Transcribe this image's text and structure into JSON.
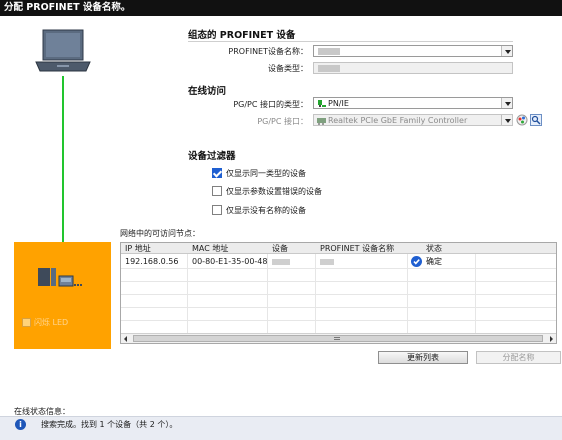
{
  "window": {
    "title": "分配 PROFINET 设备名称。"
  },
  "config": {
    "heading": "组态的 PROFINET 设备",
    "device_name_label": "PROFINET设备名称：",
    "device_name_value": "",
    "device_type_label": "设备类型：",
    "device_type_value": ""
  },
  "online": {
    "heading": "在线访问",
    "pgpc_type_label": "PG/PC 接口的类型：",
    "pgpc_type_value": "PN/IE",
    "pgpc_iface_label": "PG/PC 接口：",
    "pgpc_iface_value": "Realtek PCIe GbE Family Controller"
  },
  "filter": {
    "heading": "设备过滤器",
    "options": [
      {
        "label": "仅显示同一类型的设备",
        "checked": true
      },
      {
        "label": "仅显示参数设置错误的设备",
        "checked": false
      },
      {
        "label": "仅显示没有名称的设备",
        "checked": false
      }
    ]
  },
  "nodes": {
    "heading": "网络中的可访问节点：",
    "columns": [
      "IP 地址",
      "MAC 地址",
      "设备",
      "PROFINET 设备名称",
      "状态"
    ],
    "rows": [
      {
        "ip": "192.168.0.56",
        "mac": "00-80-E1-35-00-48",
        "device": "",
        "name": "",
        "status": "确定"
      }
    ]
  },
  "side_panel": {
    "flash_led_label": "闪烁 LED",
    "flash_led_checked": false
  },
  "buttons": {
    "refresh": "更新列表",
    "assign": "分配名称"
  },
  "status": {
    "heading": "在线状态信息：",
    "message": "搜索完成。找到 1 个设备（共 2 个）。"
  },
  "colors": {
    "panel_orange": "#ffa200",
    "link_green": "#22c52e",
    "title_bg": "#111111"
  }
}
